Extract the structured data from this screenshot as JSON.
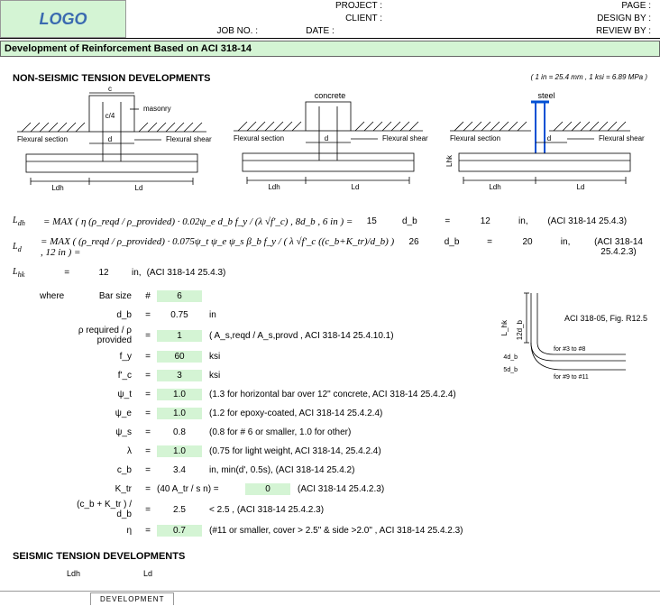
{
  "header": {
    "logo": "LOGO",
    "project": "PROJECT :",
    "client": "CLIENT :",
    "jobno": "JOB NO. :",
    "date": "DATE :",
    "page": "PAGE :",
    "designby": "DESIGN BY :",
    "reviewby": "REVIEW BY :"
  },
  "title_bar": "Development of Reinforcement  Based on ACI 318-14",
  "section1": {
    "heading": "NON-SEISMIC TENSION DEVELOPMENTS",
    "unit_note": "( 1 in = 25.4 mm , 1 ksi = 6.89 MPa )"
  },
  "diagrams": {
    "labels": {
      "a": "masonry",
      "b": "concrete",
      "c": "steel"
    },
    "flexural_section": "Flexural section",
    "flexural_shear": "Flexural shear",
    "d": "d",
    "c": "c",
    "c4": "c/4",
    "ldh": "Ldh",
    "ld": "Ld",
    "lhk": "Lhk"
  },
  "eq1": {
    "lhs": "L",
    "sub": "dh",
    "formula": " = MAX ( η (ρ_reqd / ρ_provided) · 0.02ψ_e d_b f_y / (λ √f'_c) ,  8d_b ,  6  in ) =",
    "result_coef": "15",
    "result_db": "d_b",
    "eq": "=",
    "result_val": "12",
    "unit": "in,",
    "ref": "(ACI 318-14 25.4.3)"
  },
  "eq2": {
    "lhs": "L",
    "sub": "d",
    "formula": " = MAX ( (ρ_reqd / ρ_provided) · 0.075ψ_t ψ_e ψ_s β_b f_y / ( λ √f'_c ((c_b+K_tr)/d_b) ) ,  12  in ) =",
    "result_coef": "26",
    "result_db": "d_b",
    "eq": "=",
    "result_val": "20",
    "unit": "in,",
    "ref": "(ACI 318-14 25.4.2.3)"
  },
  "eq3": {
    "lhs": "L",
    "sub": "hk",
    "eq1": "=",
    "val": "12",
    "unit": "in,",
    "ref": "(ACI 318-14 25.4.3)"
  },
  "params": {
    "where": "where",
    "rows": [
      {
        "lbl": "Bar size",
        "eq": "#",
        "val": "6",
        "note": "",
        "inp": true
      },
      {
        "lbl": "d_b",
        "eq": "=",
        "val": "0.75",
        "note": "in",
        "inp": false
      },
      {
        "lbl": "ρ required / ρ provided",
        "eq": "=",
        "val": "1",
        "note": "( A_s,reqd / A_s,provd , ACI 318-14 25.4.10.1)",
        "inp": true
      },
      {
        "lbl": "f_y",
        "eq": "=",
        "val": "60",
        "note": "ksi",
        "inp": true
      },
      {
        "lbl": "f'_c",
        "eq": "=",
        "val": "3",
        "note": "ksi",
        "inp": true
      },
      {
        "lbl": "ψ_t",
        "eq": "=",
        "val": "1.0",
        "note": "(1.3 for horizontal bar over 12\" concrete, ACI 318-14 25.4.2.4)",
        "inp": true
      },
      {
        "lbl": "ψ_e",
        "eq": "=",
        "val": "1.0",
        "note": "(1.2 for epoxy-coated, ACI 318-14 25.4.2.4)",
        "inp": true
      },
      {
        "lbl": "ψ_s",
        "eq": "=",
        "val": "0.8",
        "note": "(0.8 for # 6 or smaller, 1.0 for other)",
        "inp": false
      },
      {
        "lbl": "λ",
        "eq": "=",
        "val": "1.0",
        "note": "(0.75 for light weight, ACI 318-14, 25.4.2.4)",
        "inp": true
      },
      {
        "lbl": "c_b",
        "eq": "=",
        "val": "3.4",
        "note": "in, min(d', 0.5s), (ACI 318-14 25.4.2)",
        "inp": false
      },
      {
        "lbl": "K_tr",
        "eq": "=",
        "val": "(40 A_tr / s n) =",
        "note": "(ACI 318-14 25.4.2.3)",
        "inp": false,
        "val2": "0",
        "inp2": true
      },
      {
        "lbl": "(c_b + K_tr ) / d_b",
        "eq": "=",
        "val": "2.5",
        "note": "<  2.5 , (ACI 318-14 25.4.2.3)",
        "inp": false
      },
      {
        "lbl": "η",
        "eq": "=",
        "val": "0.7",
        "note": "(#11 or smaller, cover > 2.5\" & side >2.0\" ,   ACI 318-14 25.4.2.3)",
        "inp": true
      }
    ]
  },
  "hook_figure": {
    "ref": "ACI 318-05, Fig. R12.5",
    "v": "12d_b",
    "h3": "for #3 to #8",
    "h9": "for #9 to #11",
    "d4": "4d_b",
    "d5": "5d_b",
    "lhk": "L_hk"
  },
  "section2": {
    "heading": "SEISMIC TENSION DEVELOPMENTS"
  },
  "bottom": {
    "ldh": "Ldh",
    "ld": "Ld"
  },
  "tab": "DEVELOPMENT"
}
